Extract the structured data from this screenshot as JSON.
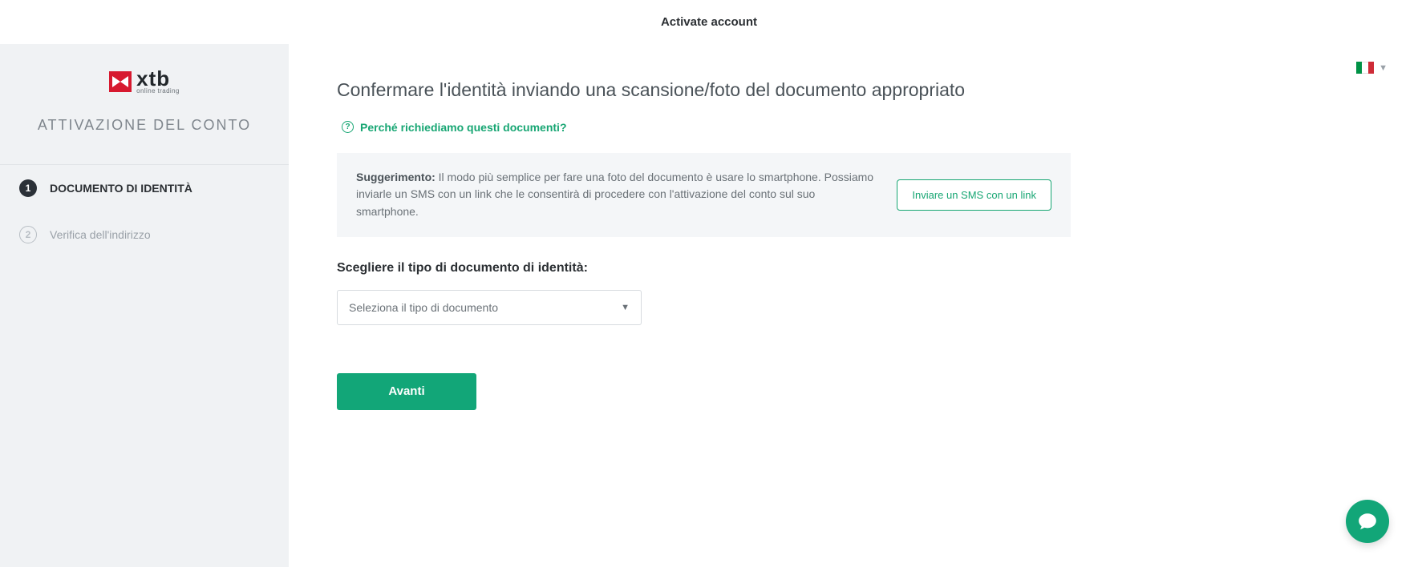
{
  "header": {
    "title": "Activate account"
  },
  "brand": {
    "name": "xtb",
    "tagline": "online trading"
  },
  "sidebar": {
    "title": "ATTIVAZIONE DEL CONTO",
    "steps": [
      {
        "num": "1",
        "label": "DOCUMENTO DI IDENTITÀ"
      },
      {
        "num": "2",
        "label": "Verifica dell'indirizzo"
      }
    ]
  },
  "lang": {
    "caret": "▼"
  },
  "main": {
    "title": "Confermare l'identità inviando una scansione/foto del documento appropriato",
    "help_link": "Perché richiediamo questi documenti?",
    "tip_label": "Suggerimento:",
    "tip_body": " Il modo più semplice per fare una foto del documento è usare lo smartphone. Possiamo inviarle un SMS con un link che le consentirà di procedere con l'attivazione del conto sul suo smartphone.",
    "sms_button": "Inviare un SMS con un link",
    "field_label": "Scegliere il tipo di documento di identità:",
    "select_placeholder": "Seleziona il tipo di documento",
    "next": "Avanti"
  },
  "colors": {
    "accent": "#12a678",
    "brand_red": "#d7192f"
  }
}
